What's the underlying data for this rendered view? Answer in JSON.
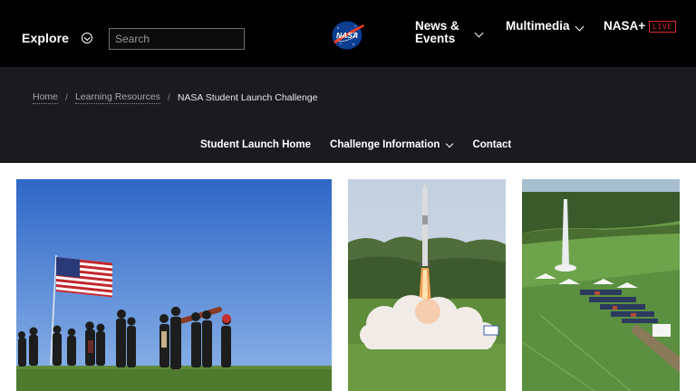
{
  "header": {
    "explore_label": "Explore",
    "search_placeholder": "Search",
    "nav": {
      "news_events_line1": "News &",
      "news_events_line2": "Events",
      "multimedia": "Multimedia",
      "nasa_plus": "NASA+",
      "live_badge": "LIVE"
    },
    "logo_text": "NASA"
  },
  "breadcrumb": {
    "items": [
      "Home",
      "Learning Resources"
    ],
    "separator": "/",
    "current": "NASA Student Launch Challenge"
  },
  "subnav": {
    "items": [
      "Student Launch Home",
      "Challenge Information",
      "Contact"
    ]
  },
  "colors": {
    "header_bg": "#000000",
    "subbar_bg": "#1b1b1f",
    "live_red": "#e02a2a",
    "nasa_blue": "#0b3d91",
    "nasa_red": "#fc3d21"
  },
  "gallery": {
    "photos": [
      {
        "name": "students-carrying-rocket-with-flag"
      },
      {
        "name": "rocket-launch-with-smoke"
      },
      {
        "name": "launch-field-aerial-view"
      }
    ]
  }
}
